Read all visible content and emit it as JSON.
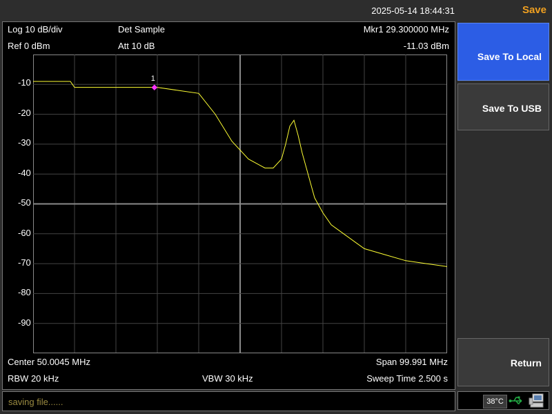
{
  "header": {
    "datetime": "2025-05-14 18:44:31",
    "menu_title": "Save"
  },
  "display": {
    "scale": "Log 10 dB/div",
    "detector": "Det Sample",
    "marker_freq": "Mkr1  29.300000 MHz",
    "reference": "Ref 0 dBm",
    "attenuation": "Att 10 dB",
    "marker_level": "-11.03 dBm",
    "center": "Center 50.0045 MHz",
    "span": "Span 99.991 MHz",
    "rbw": "RBW 20 kHz",
    "vbw": "VBW 30 kHz",
    "sweep_time": "Sweep Time 2.500 s",
    "marker_label": "1"
  },
  "y_tick_labels": [
    "-10",
    "-20",
    "-30",
    "-40",
    "-50",
    "-60",
    "-70",
    "-80",
    "-90"
  ],
  "softkeys": {
    "save_to_local": "Save To Local",
    "save_to_usb": "Save To USB",
    "return": "Return"
  },
  "status": {
    "message": "saving file......",
    "temperature": "38°C"
  },
  "colors": {
    "trace": "#ffff33",
    "marker": "#ff33ff",
    "accent": "#f0a020",
    "active_key": "#2c5de5"
  },
  "chart_data": {
    "type": "line",
    "ylim": [
      -100,
      0
    ],
    "y_unit": "dBm",
    "center_mhz": 50.0045,
    "span_mhz": 99.991,
    "grid": true,
    "series": [
      {
        "x": [
          0.0,
          9,
          10,
          20,
          30,
          35,
          40,
          44,
          48,
          52,
          56,
          58,
          60,
          61,
          62,
          63,
          64,
          65,
          66,
          67,
          68,
          70,
          72,
          75,
          78,
          80,
          85,
          90,
          95,
          100
        ],
        "y": [
          -9,
          -9,
          -11,
          -11,
          -11,
          -12,
          -13,
          -20,
          -29,
          -35,
          -38,
          -38,
          -35,
          -30,
          -24,
          -22,
          -27,
          -33,
          -38,
          -43,
          -48,
          -53,
          -57,
          -60,
          -63,
          -65,
          -67,
          -69,
          -70,
          -71
        ]
      }
    ],
    "marker": {
      "label": "1",
      "freq_mhz": 29.3,
      "level_dbm": -11.03
    }
  }
}
